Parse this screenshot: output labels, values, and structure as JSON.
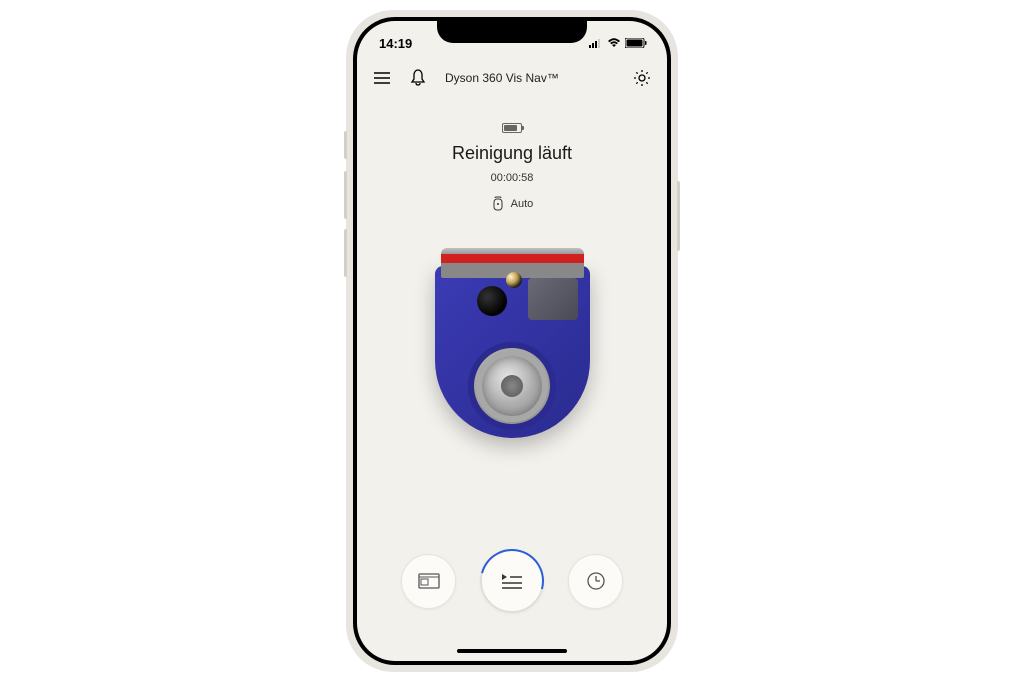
{
  "status_bar": {
    "time": "14:19"
  },
  "header": {
    "device_name": "Dyson 360 Vis Nav™"
  },
  "status": {
    "title": "Reinigung läuft",
    "timer": "00:00:58",
    "mode": "Auto"
  },
  "icons": {
    "menu": "menu-icon",
    "bell": "bell-icon",
    "gear": "gear-icon",
    "battery": "battery-icon",
    "mode": "auto-mode-icon",
    "map": "map-icon",
    "queue": "queue-icon",
    "clock": "clock-icon"
  }
}
